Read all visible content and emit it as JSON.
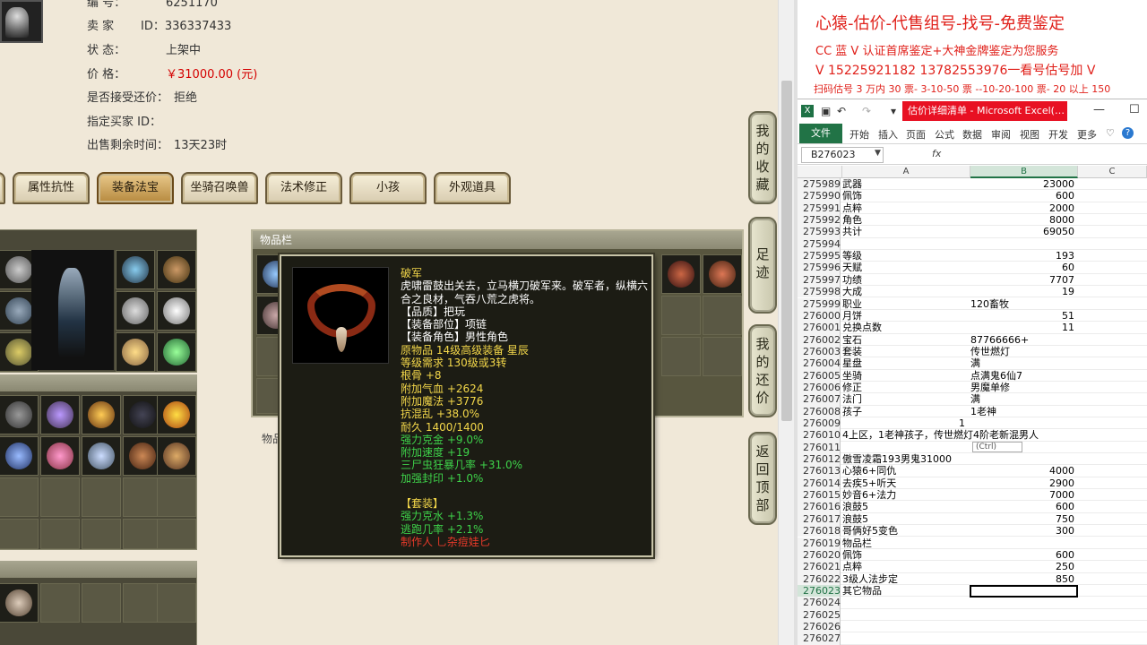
{
  "item_info": {
    "id_label": "编  号：",
    "id_value": "6251170",
    "seller_label": "卖  家",
    "seller_value": "ID：336337433",
    "status_label": "状  态：",
    "status_value": "上架中",
    "price_label": "价  格：",
    "price_value": "￥31000.00 (元)",
    "counter_offer_label": "是否接受还价：",
    "counter_offer_value": "拒绝",
    "buyer_label": "指定买家 ID：",
    "buyer_value": "",
    "time_label": "出售剩余时间：",
    "time_value": "13天23时"
  },
  "tabs": [
    {
      "label": "属性抗性",
      "active": false
    },
    {
      "label": "装备法宝",
      "active": true
    },
    {
      "label": "坐骑召唤兽",
      "active": false
    },
    {
      "label": "法术修正",
      "active": false
    },
    {
      "label": "小孩",
      "active": false
    },
    {
      "label": "外观道具",
      "active": false
    }
  ],
  "bag": {
    "header": "物品栏",
    "label_below": "物品"
  },
  "side_buttons": [
    {
      "label": [
        "我",
        "的",
        "收",
        "藏"
      ]
    },
    {
      "label": [
        "足",
        "迹"
      ]
    },
    {
      "label": [
        "我",
        "的",
        "还",
        "价"
      ]
    },
    {
      "label": [
        "返",
        "回",
        "顶",
        "部"
      ]
    }
  ],
  "tooltip": {
    "name": "破军",
    "desc": "虎啸雷鼓出关去，立马横刀破军来。破军者，纵横六合之良材，气吞八荒之虎将。",
    "lines_white": [
      "【品质】把玩",
      "【装备部位】项链",
      "【装备角色】男性角色"
    ],
    "lines_yellow": [
      "原物品 14级高级装备 星辰",
      "等级需求 130级或3转",
      "根骨 +8",
      "附加气血 +2624",
      "附加魔法 +3776",
      "抗混乱 +38.0%",
      "耐久 1400/1400"
    ],
    "lines_green": [
      "强力克金 +9.0%",
      "附加速度 +19",
      "三尸虫狂暴几率 +31.0%",
      "加强封印 +1.0%"
    ],
    "set_title": "【套装】",
    "set_lines": [
      "强力克水 +1.3%",
      "逃跑几率 +2.1%"
    ],
    "maker": "制作人 乚杂痘娃匕"
  },
  "promo": {
    "line1": "心猿-估价-代售组号-找号-免费鉴定",
    "line2": "CC 蓝 V 认证首席鉴定+大神金牌鉴定为您服务",
    "line3": "V 15225921182    13782553976一看号估号加 V",
    "line4": "扫码估号 3 万内 30 票- 3-10-50 票 --10-20-100 票- 20 以上 150"
  },
  "excel": {
    "title": "估价详细清单 - Microsoft Excel(…",
    "ribbon_file": "文件",
    "ribbon_tabs": [
      "开始",
      "插入",
      "页面",
      "公式",
      "数据",
      "审阅",
      "视图",
      "开发",
      "更多"
    ],
    "name_box": "B276023",
    "fx": "fx",
    "columns": [
      "A",
      "B",
      "C"
    ],
    "paste_hint": "(Ctrl)",
    "rows": [
      {
        "n": "275989",
        "a": "武器",
        "b": "23000",
        "num": true
      },
      {
        "n": "275990",
        "a": "佩饰",
        "b": "600",
        "num": true
      },
      {
        "n": "275991",
        "a": "点粹",
        "b": "2000",
        "num": true
      },
      {
        "n": "275992",
        "a": "角色",
        "b": "8000",
        "num": true
      },
      {
        "n": "275993",
        "a": "共计",
        "b": "69050",
        "num": true
      },
      {
        "n": "275994",
        "a": "",
        "b": "",
        "num": true
      },
      {
        "n": "275995",
        "a": "等级",
        "b": "193",
        "num": true
      },
      {
        "n": "275996",
        "a": "天赋",
        "b": "60",
        "num": true
      },
      {
        "n": "275997",
        "a": "功绩",
        "b": "7707",
        "num": true
      },
      {
        "n": "275998",
        "a": "大成",
        "b": "19",
        "num": true
      },
      {
        "n": "275999",
        "a": "职业",
        "b": "120畜牧",
        "num": false
      },
      {
        "n": "276000",
        "a": "月饼",
        "b": "51",
        "num": true
      },
      {
        "n": "276001",
        "a": "兑换点数",
        "b": "11",
        "num": true
      },
      {
        "n": "276002",
        "a": "宝石",
        "b": "87766666+",
        "num": false
      },
      {
        "n": "276003",
        "a": "套装",
        "b": "传世燃灯",
        "num": false
      },
      {
        "n": "276004",
        "a": "星盘",
        "b": "满",
        "num": false
      },
      {
        "n": "276005",
        "a": "坐骑",
        "b": "点满鬼6仙7",
        "num": false
      },
      {
        "n": "276006",
        "a": "修正",
        "b": "男魔单修",
        "num": false
      },
      {
        "n": "276007",
        "a": "法门",
        "b": "满",
        "num": false
      },
      {
        "n": "276008",
        "a": "孩子",
        "b": "1老神",
        "num": false
      },
      {
        "n": "276009",
        "a": "1",
        "b": "",
        "num": false
      },
      {
        "n": "276010",
        "a": "4上区，1老神孩子，传世燃灯4阶老新混男人",
        "b": "",
        "num": false
      },
      {
        "n": "276011",
        "a": "",
        "b": "",
        "num": false
      },
      {
        "n": "276012",
        "a": "傲雪凌霜193男鬼31000",
        "b": "",
        "num": false
      },
      {
        "n": "276013",
        "a": "心猿6+同仇",
        "b": "4000",
        "num": true
      },
      {
        "n": "276014",
        "a": "去疾5+听天",
        "b": "2900",
        "num": true
      },
      {
        "n": "276015",
        "a": "妙音6+法力",
        "b": "7000",
        "num": true
      },
      {
        "n": "276016",
        "a": "浪鼓5",
        "b": "600",
        "num": true
      },
      {
        "n": "276017",
        "a": "浪鼓5",
        "b": "750",
        "num": true
      },
      {
        "n": "276018",
        "a": "哥俩好5变色",
        "b": "300",
        "num": true
      },
      {
        "n": "276019",
        "a": "物品栏",
        "b": "",
        "num": true
      },
      {
        "n": "276020",
        "a": "佩饰",
        "b": "600",
        "num": true
      },
      {
        "n": "276021",
        "a": "点粹",
        "b": "250",
        "num": true
      },
      {
        "n": "276022",
        "a": "3级人法步定",
        "b": "850",
        "num": true
      },
      {
        "n": "276023",
        "a": "其它物品",
        "b": "",
        "num": true
      },
      {
        "n": "276024",
        "a": "",
        "b": "",
        "num": true
      },
      {
        "n": "276025",
        "a": "",
        "b": "",
        "num": true
      },
      {
        "n": "276026",
        "a": "",
        "b": "",
        "num": true
      },
      {
        "n": "276027",
        "a": "",
        "b": "",
        "num": true
      }
    ]
  }
}
